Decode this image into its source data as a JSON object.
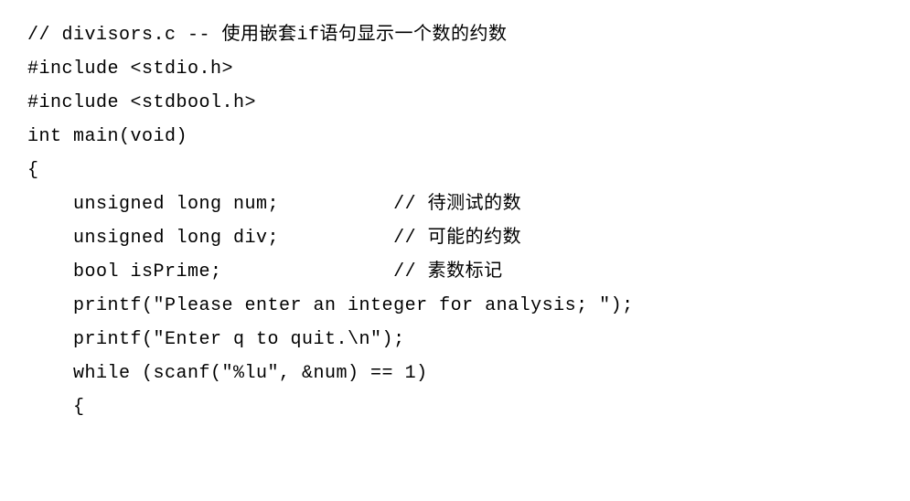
{
  "code": {
    "line1": "// divisors.c -- 使用嵌套if语句显示一个数的约数",
    "line2": "#include <stdio.h>",
    "line3": "#include <stdbool.h>",
    "line4": "int main(void)",
    "line5": "{",
    "line6": "    unsigned long num;          // 待测试的数",
    "line7": "    unsigned long div;          // 可能的约数",
    "line8": "    bool isPrime;               // 素数标记",
    "line9": "",
    "line10": "    printf(\"Please enter an integer for analysis; \");",
    "line11": "    printf(\"Enter q to quit.\\n\");",
    "line12": "    while (scanf(\"%lu\", &num) == 1)",
    "line13": "    {"
  }
}
